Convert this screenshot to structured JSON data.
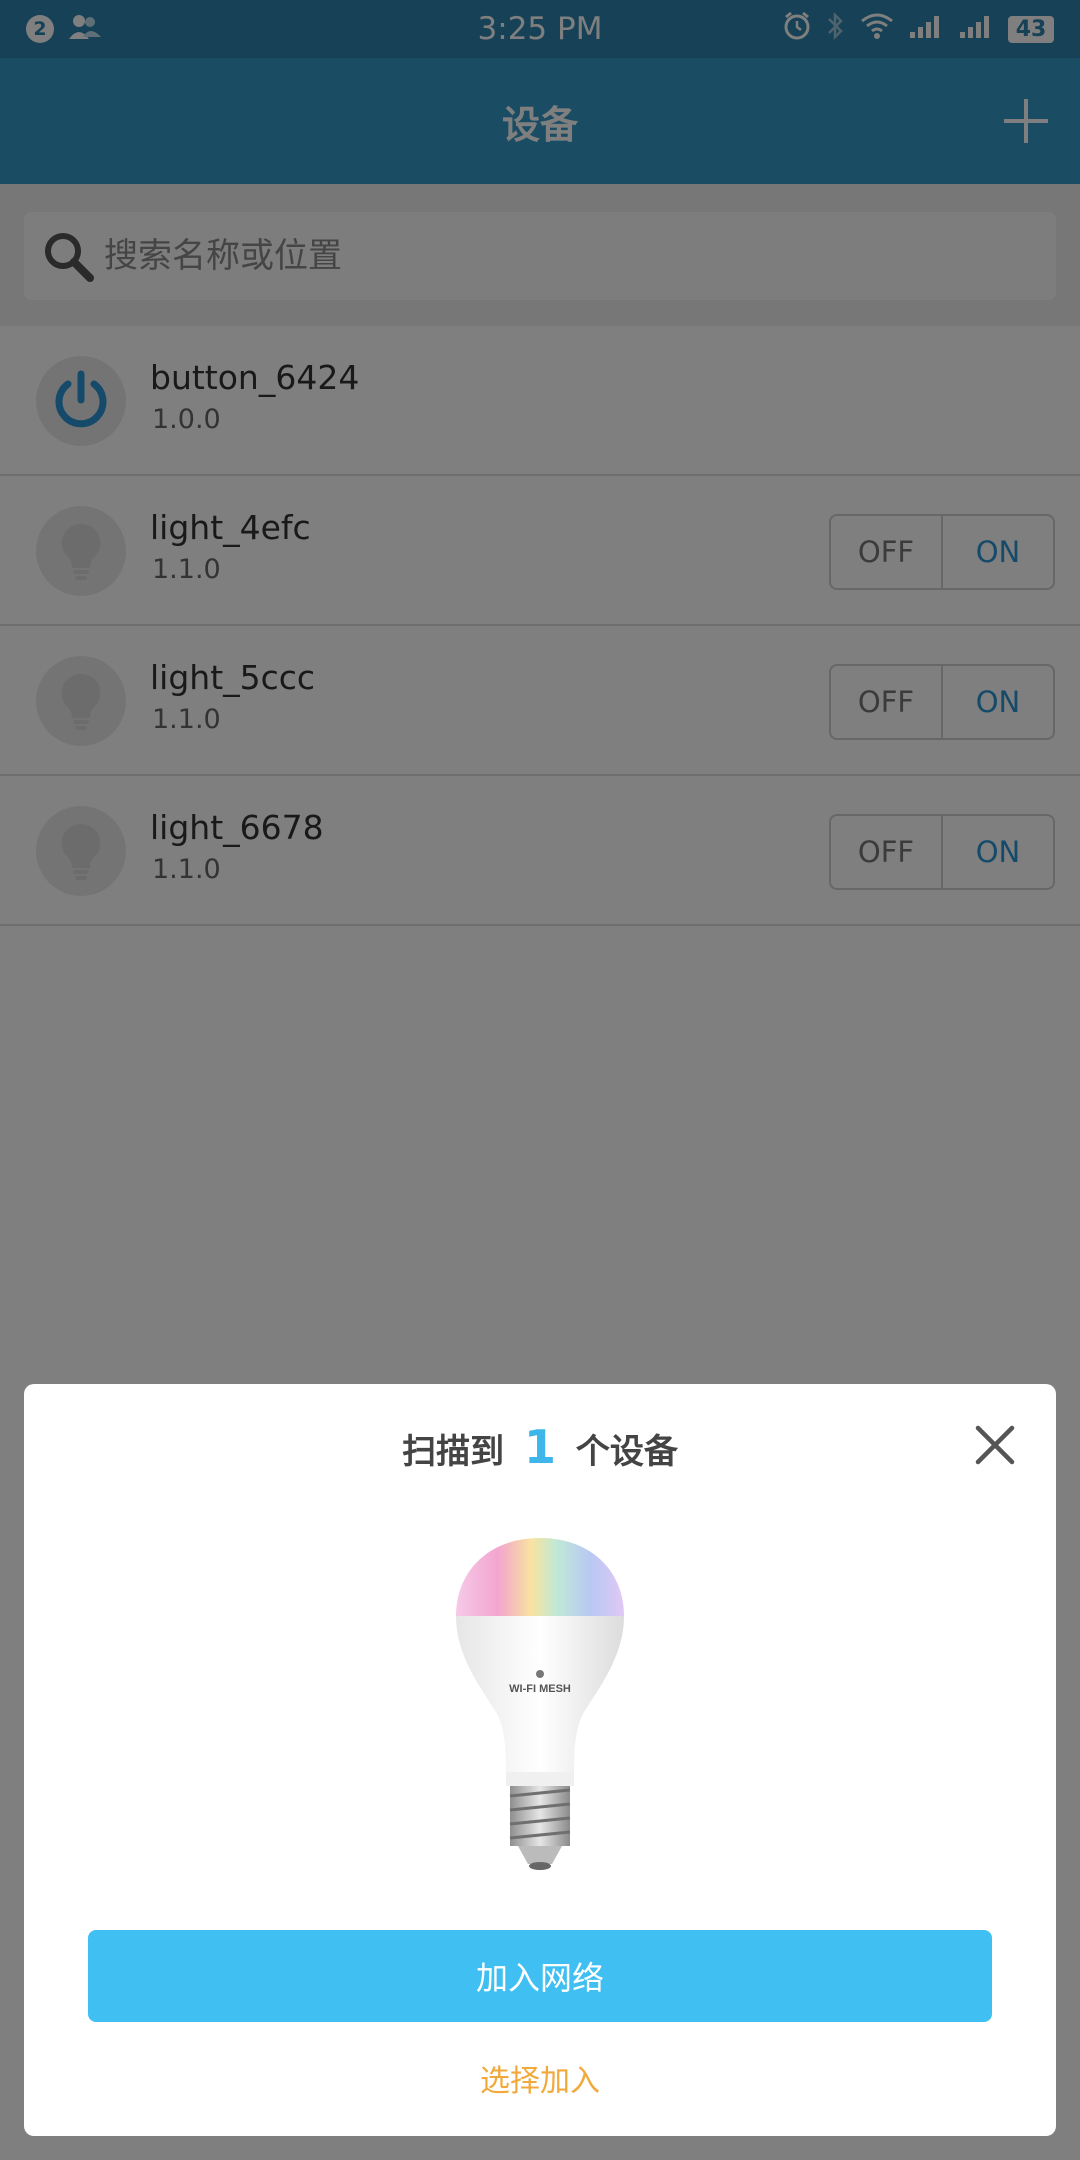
{
  "status_bar": {
    "notification_count": "2",
    "time": "3:25 PM",
    "battery": "43",
    "icons": [
      "contacts-icon",
      "alarm-icon",
      "bluetooth-icon",
      "wifi-icon",
      "signal-icon",
      "signal-icon-2",
      "battery-icon"
    ]
  },
  "header": {
    "title": "设备",
    "add_icon": "plus-icon"
  },
  "search": {
    "placeholder": "搜索名称或位置",
    "icon": "search-icon"
  },
  "devices": [
    {
      "name": "button_6424",
      "version": "1.0.0",
      "type": "button",
      "icon": "power-icon",
      "has_toggle": false
    },
    {
      "name": "light_4efc",
      "version": "1.1.0",
      "type": "light",
      "icon": "lightbulb-icon",
      "has_toggle": true,
      "toggle": {
        "off": "OFF",
        "on": "ON"
      }
    },
    {
      "name": "light_5ccc",
      "version": "1.1.0",
      "type": "light",
      "icon": "lightbulb-icon",
      "has_toggle": true,
      "toggle": {
        "off": "OFF",
        "on": "ON"
      }
    },
    {
      "name": "light_6678",
      "version": "1.1.0",
      "type": "light",
      "icon": "lightbulb-icon",
      "has_toggle": true,
      "toggle": {
        "off": "OFF",
        "on": "ON"
      }
    }
  ],
  "dialog": {
    "title_prefix": "扫描到",
    "title_count": "1",
    "title_suffix": "个设备",
    "close_icon": "close-icon",
    "image": "lightbulb-product-image",
    "bulb_label": "WI-FI MESH",
    "join_button": "加入网络",
    "select_link": "选择加入"
  },
  "colors": {
    "status_bar": "#2d83ad",
    "header": "#3598c9",
    "accent_blue": "#40c0f2",
    "on_blue": "#2a95d4",
    "link_orange": "#f2a93b"
  }
}
